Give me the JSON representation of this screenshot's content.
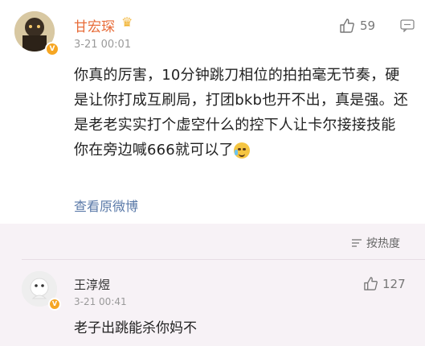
{
  "comment": {
    "username": "甘宏琛",
    "time": "3-21 00:01",
    "likes": "59",
    "text": "你真的厉害，10分钟跳刀相位的拍拍毫无节奏，硬是让你打成互刷局，打团bkb也开不出，真是强。还是老老实实打个虚空什么的控下人让卡尔接接技能 你在旁边喊666就可以了",
    "view_original": "查看原微博"
  },
  "sort": {
    "label": "按热度"
  },
  "reply": {
    "username": "王淳煜",
    "time": "3-21 00:41",
    "likes": "127",
    "text": "老子出跳能杀你妈不"
  },
  "colors": {
    "username_orange": "#e86d3a",
    "link_blue": "#5a79a8",
    "badge_yellow": "#f6a623",
    "section_bg": "#f7f2f6"
  },
  "icons": [
    "thumbs-up-icon",
    "reply-icon",
    "sort-icon",
    "verified-badge-icon",
    "crown-icon",
    "crying-emoji-icon"
  ]
}
